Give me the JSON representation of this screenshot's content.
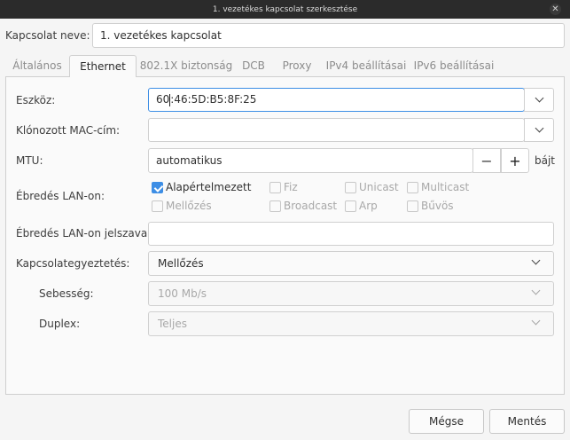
{
  "window": {
    "title": "1. vezetékes kapcsolat szerkesztése"
  },
  "connection": {
    "name_label": "Kapcsolat neve:",
    "name_value": "1. vezetékes kapcsolat"
  },
  "tabs": [
    {
      "label": "Általános"
    },
    {
      "label": "Ethernet"
    },
    {
      "label": "802.1X biztonság"
    },
    {
      "label": "DCB"
    },
    {
      "label": "Proxy"
    },
    {
      "label": "IPv4 beállításai"
    },
    {
      "label": "IPv6 beállításai"
    }
  ],
  "form": {
    "device_label": "Eszköz:",
    "device_value_before_caret": "60",
    "device_value_after_caret": ":46:5D:B5:8F:25",
    "cloned_mac_label": "Klónozott MAC-cím:",
    "cloned_mac_value": "",
    "mtu_label": "MTU:",
    "mtu_value": "automatikus",
    "mtu_minus": "−",
    "mtu_plus": "+",
    "mtu_unit": "bájt",
    "wol_label": "Ébredés LAN-on:",
    "wol_options": [
      {
        "label": "Alapértelmezett",
        "checked": true
      },
      {
        "label": "Fiz",
        "checked": false
      },
      {
        "label": "Unicast",
        "checked": false
      },
      {
        "label": "Multicast",
        "checked": false
      },
      {
        "label": "Mellőzés",
        "checked": false
      },
      {
        "label": "Broadcast",
        "checked": false
      },
      {
        "label": "Arp",
        "checked": false
      },
      {
        "label": "Bűvös",
        "checked": false
      }
    ],
    "wol_password_label": "Ébredés LAN-on jelszava:",
    "wol_password_value": "",
    "negotiation_label": "Kapcsolategyeztetés:",
    "negotiation_value": "Mellőzés",
    "speed_label": "Sebesség:",
    "speed_value": "100 Mb/s",
    "duplex_label": "Duplex:",
    "duplex_value": "Teljes"
  },
  "buttons": {
    "cancel": "Mégse",
    "save": "Mentés"
  },
  "colors": {
    "accent": "#3d8ee5",
    "titlebar": "#2b2b2b"
  },
  "icons": {
    "close": "close-icon",
    "dropdown": "chevron-down-icon",
    "check": "check-icon"
  }
}
